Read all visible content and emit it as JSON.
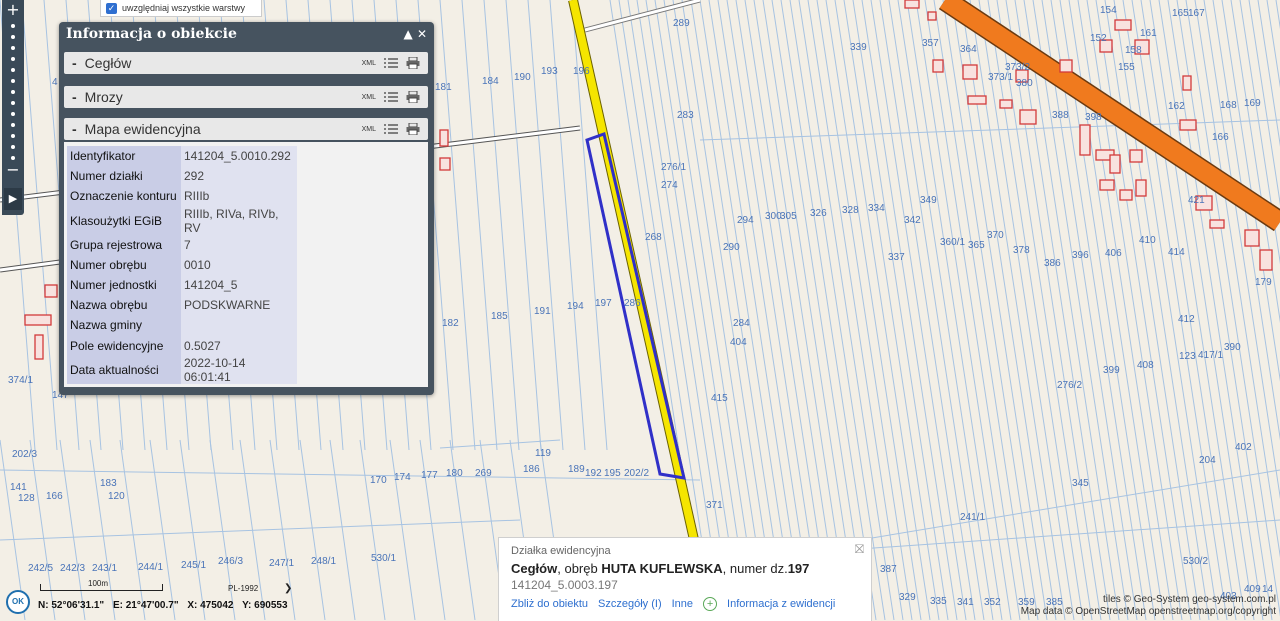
{
  "layers_option": {
    "label": "uwzględniaj wszystkie warstwy",
    "checked": true
  },
  "info_panel": {
    "title": "Informacja o obiekcie",
    "controls": "▲ ✕",
    "sections": [
      {
        "label": "Cegłów",
        "xml": "XML"
      },
      {
        "label": "Mrozy",
        "xml": "XML"
      },
      {
        "label": "Mapa ewidencyjna",
        "xml": "XML"
      }
    ],
    "attributes": [
      {
        "key": "Identyfikator",
        "value": "141204_5.0010.292"
      },
      {
        "key": "Numer działki",
        "value": "292"
      },
      {
        "key": "Oznaczenie konturu",
        "value": "RIIIb"
      },
      {
        "key": "Klasoużytki EGiB",
        "value": "RIIIb, RIVa, RIVb, RV"
      },
      {
        "key": "Grupa rejestrowa",
        "value": "7"
      },
      {
        "key": "Numer obrębu",
        "value": "0010"
      },
      {
        "key": "Numer jednostki",
        "value": "141204_5"
      },
      {
        "key": "Nazwa obrębu",
        "value": "PODSKWARNE"
      },
      {
        "key": "Nazwa gminy",
        "value": ""
      },
      {
        "key": "Pole ewidencyjne",
        "value": "0.5027"
      },
      {
        "key": "Data aktualności",
        "value": "2022-10-14 06:01:41"
      }
    ]
  },
  "popup": {
    "type": "Działka ewidencyjna",
    "gmina": "Cegłów",
    "mid": ", obręb ",
    "obreb": "HUTA KUFLEWSKA",
    "num_prefix": ", numer dz.",
    "numer": "197",
    "identifier": "141204_5.0003.197",
    "close": "⛝",
    "links": {
      "zoom": "Zbliż do obiektu",
      "details": "Szczegóły (I)",
      "other": "Inne",
      "registry": "Informacja z ewidencji"
    }
  },
  "status": {
    "ok": "OK",
    "scale": "100m",
    "crs": "PL-1992",
    "lat": "N: 52°06'31.1\"",
    "lon": "E: 21°47'00.7\"",
    "x": "X: 475042",
    "y": "Y: 690553"
  },
  "attribution": {
    "line1": "tiles © Geo-System geo-system.com.pl",
    "line2": "Map data © OpenStreetMap openstreetmap.org/copyright"
  },
  "parcel_labels": [
    "289",
    "339",
    "357",
    "364",
    "373/2",
    "373/1",
    "380",
    "154",
    "161",
    "165",
    "167",
    "152",
    "158",
    "155",
    "169",
    "168",
    "162",
    "166",
    "193",
    "196",
    "181",
    "184",
    "190",
    "283",
    "388",
    "398",
    "276/1",
    "274",
    "268",
    "294",
    "300",
    "305",
    "326",
    "328",
    "334",
    "342",
    "349",
    "290",
    "337",
    "360/1",
    "365",
    "370",
    "378",
    "386",
    "396",
    "406",
    "410",
    "414",
    "421",
    "179",
    "182",
    "185",
    "191",
    "194",
    "197",
    "286",
    "284",
    "404",
    "412",
    "417/1",
    "390",
    "399",
    "408",
    "123",
    "374/1",
    "276/2",
    "415",
    "402",
    "204",
    "119",
    "202/3",
    "183",
    "186",
    "189",
    "192",
    "195",
    "202/2",
    "141",
    "120",
    "128",
    "166",
    "170",
    "174",
    "177",
    "180",
    "269",
    "371",
    "345",
    "241/1",
    "242/5",
    "242/3",
    "243/1",
    "244/1",
    "245/1",
    "246/3",
    "247/1",
    "248/1",
    "530/1",
    "530/2",
    "387",
    "329",
    "335",
    "341",
    "352",
    "359",
    "385",
    "403",
    "409",
    "14",
    "4",
    "147"
  ],
  "colors": {
    "map_bg": "#f3efe6",
    "parcel_lines": "#a7c3e2",
    "parcel_text": "#4a74b8",
    "road_yellow": "#f5e500",
    "road_orange": "#f07a1e",
    "selection": "#3030c8",
    "building": "#d23a3a",
    "panel": "#46535f"
  },
  "icons": [
    "zoom-in-icon",
    "zoom-out-icon",
    "expand-icon",
    "checkbox-icon",
    "collapse-icon",
    "close-icon",
    "list-icon",
    "print-icon",
    "add-circle-icon",
    "ok-icon",
    "chevron-down-icon"
  ]
}
